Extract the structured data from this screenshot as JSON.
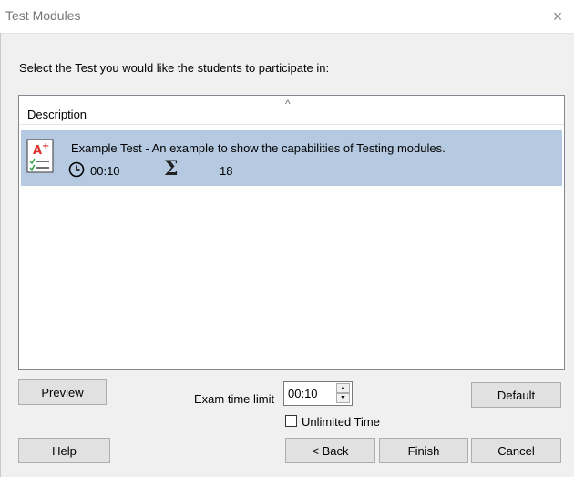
{
  "window": {
    "title": "Test Modules",
    "close_glyph": "×"
  },
  "instruction": "Select the Test you would like the students to participate in:",
  "list": {
    "column_header": "Description",
    "sort_glyph": "^",
    "items": [
      {
        "title": "Example Test - An example to show the capabilities of Testing modules.",
        "time": "00:10",
        "count": "18",
        "icon": "test-grade-icon"
      }
    ]
  },
  "buttons": {
    "preview": "Preview",
    "default": "Default",
    "help": "Help",
    "back": "< Back",
    "finish": "Finish",
    "cancel": "Cancel"
  },
  "exam_time": {
    "label": "Exam time limit",
    "value": "00:10"
  },
  "unlimited_time": {
    "label": "Unlimited Time",
    "checked": false
  },
  "colors": {
    "selection": "#b5c9e1",
    "button": "#e1e1e1",
    "background": "#f0f0f0"
  }
}
